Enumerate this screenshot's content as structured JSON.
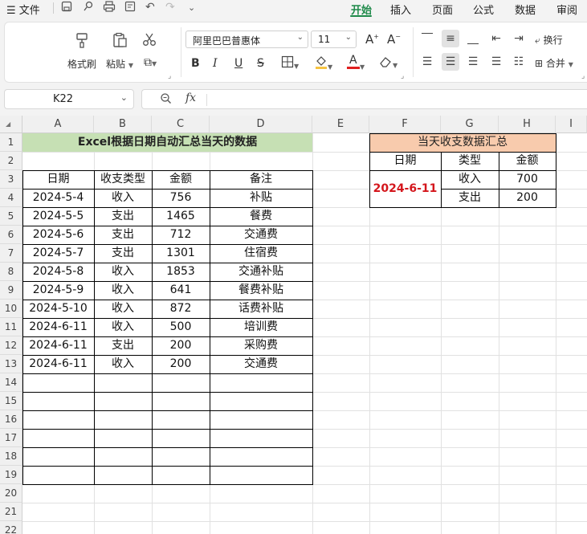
{
  "menubar": {
    "file_label": "文件",
    "tabs": [
      "开始",
      "插入",
      "页面",
      "公式",
      "数据",
      "审阅"
    ]
  },
  "ribbon": {
    "format_painter": "格式刷",
    "paste": "粘贴",
    "font_name": "阿里巴巴普惠体",
    "font_size": "11",
    "wrap_text": "换行",
    "merge": "合并"
  },
  "formula_bar": {
    "name_box": "K22",
    "fx": "fx",
    "formula": ""
  },
  "sheet": {
    "columns": [
      "A",
      "B",
      "C",
      "D",
      "E",
      "F",
      "G",
      "H",
      "I"
    ],
    "rows": [
      "1",
      "2",
      "3",
      "4",
      "5",
      "6",
      "7",
      "8",
      "9",
      "10",
      "11",
      "12",
      "13",
      "14",
      "15",
      "16",
      "17",
      "18",
      "19",
      "20",
      "21",
      "22"
    ],
    "title_left": "Excel根据日期自动汇总当天的数据",
    "headers_left": [
      "日期",
      "收支类型",
      "金额",
      "备注"
    ],
    "data_rows": [
      [
        "2024-5-4",
        "收入",
        "756",
        "补贴"
      ],
      [
        "2024-5-5",
        "支出",
        "1465",
        "餐费"
      ],
      [
        "2024-5-6",
        "支出",
        "712",
        "交通费"
      ],
      [
        "2024-5-7",
        "支出",
        "1301",
        "住宿费"
      ],
      [
        "2024-5-8",
        "收入",
        "1853",
        "交通补贴"
      ],
      [
        "2024-5-9",
        "收入",
        "641",
        "餐费补贴"
      ],
      [
        "2024-5-10",
        "收入",
        "872",
        "话费补贴"
      ],
      [
        "2024-6-11",
        "收入",
        "500",
        "培训费"
      ],
      [
        "2024-6-11",
        "支出",
        "200",
        "采购费"
      ],
      [
        "2024-6-11",
        "收入",
        "200",
        "交通费"
      ]
    ],
    "title_right": "当天收支数据汇总",
    "headers_right": [
      "日期",
      "类型",
      "金额"
    ],
    "summary_date": "2024-6-11",
    "summary_rows": [
      [
        "收入",
        "700"
      ],
      [
        "支出",
        "200"
      ]
    ]
  },
  "colors": {
    "accent": "#1f8a4a",
    "title_left_bg": "#c6e0b4",
    "title_right_bg": "#f8cbad",
    "summary_date": "#d4161c",
    "font_color_bar": "#e02020"
  }
}
